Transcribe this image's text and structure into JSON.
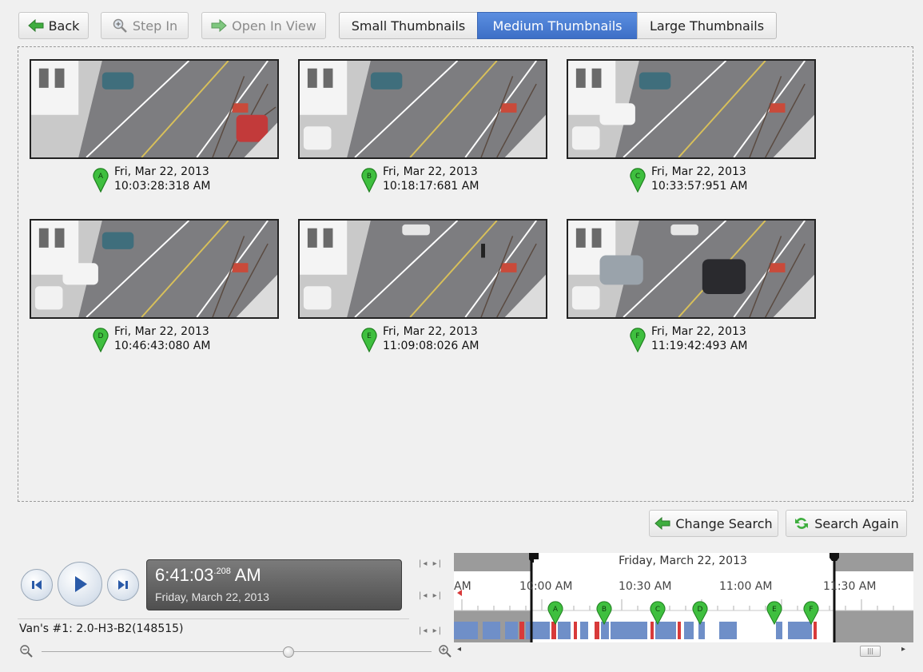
{
  "toolbar": {
    "back": "Back",
    "step_in": "Step In",
    "open_in_view": "Open In View",
    "small": "Small Thumbnails",
    "medium": "Medium Thumbnails",
    "large": "Large Thumbnails"
  },
  "results": [
    {
      "marker": "A",
      "date": "Fri, Mar 22, 2013",
      "time": "10:03:28:318 AM"
    },
    {
      "marker": "B",
      "date": "Fri, Mar 22, 2013",
      "time": "10:18:17:681 AM"
    },
    {
      "marker": "C",
      "date": "Fri, Mar 22, 2013",
      "time": "10:33:57:951 AM"
    },
    {
      "marker": "D",
      "date": "Fri, Mar 22, 2013",
      "time": "10:46:43:080 AM"
    },
    {
      "marker": "E",
      "date": "Fri, Mar 22, 2013",
      "time": "11:09:08:026 AM"
    },
    {
      "marker": "F",
      "date": "Fri, Mar 22, 2013",
      "time": "11:19:42:493 AM"
    }
  ],
  "actions": {
    "change_search": "Change Search",
    "search_again": "Search Again"
  },
  "clock": {
    "time": "6:41:03",
    "ms": ".208",
    "ampm": "AM",
    "date": "Friday, March 22, 2013"
  },
  "camera": "Van's #1: 2.0-H3-B2(148515)",
  "timeline": {
    "date": "Friday, March 22, 2013",
    "ticks": [
      "AM",
      "10:00 AM",
      "10:30 AM",
      "11:00 AM",
      "11:30 AM"
    ],
    "markers": [
      "A",
      "B",
      "C",
      "D",
      "E",
      "F"
    ]
  },
  "colors": {
    "accent": "#3d6fc6",
    "marker_green": "#3fbf3f",
    "event_blue": "#6f8fc8",
    "event_red": "#d83a3a"
  },
  "icons": {
    "back": "arrow-left-icon",
    "step_in": "zoom-in-icon",
    "open_in_view": "arrow-right-icon",
    "change_search": "arrow-left-icon",
    "search_again": "refresh-icon"
  }
}
